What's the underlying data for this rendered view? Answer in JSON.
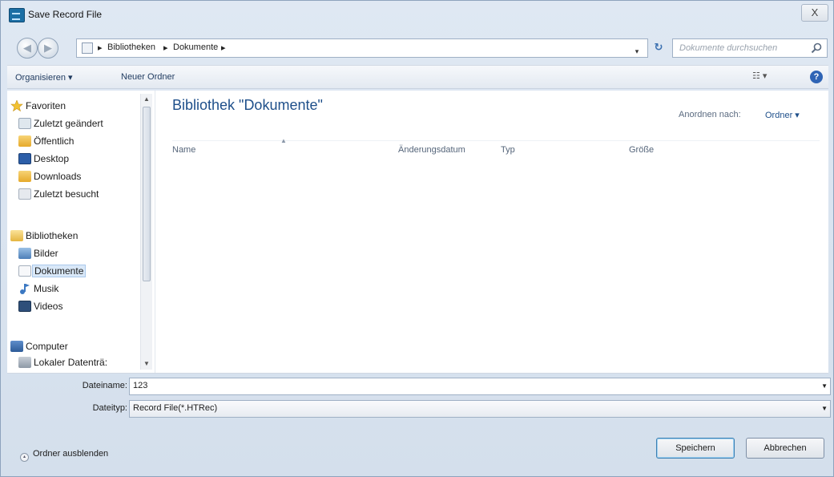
{
  "window": {
    "title": "Save Record File",
    "close_glyph": "X"
  },
  "address": {
    "crumbs": [
      "Bibliotheken",
      "Dokumente"
    ],
    "separator": "▸",
    "dropdown_glyph": "▾",
    "refresh_glyph": "↻"
  },
  "search": {
    "placeholder": "Dokumente durchsuchen",
    "icon": "search-icon"
  },
  "toolbar": {
    "organize_label": "Organisieren ▾",
    "new_folder_label": "Neuer Ordner",
    "view_label": "☷ ▾",
    "help_label": "?"
  },
  "navigation": {
    "favorites": {
      "label": "Favoriten",
      "items": [
        "Zuletzt geändert",
        "Öffentlich",
        "Desktop",
        "Downloads",
        "Zuletzt besucht"
      ]
    },
    "libraries": {
      "label": "Bibliotheken",
      "items": [
        "Bilder",
        "Dokumente",
        "Musik",
        "Videos"
      ],
      "selected": "Dokumente"
    },
    "computer": {
      "label": "Computer",
      "items": [
        "Lokaler Datenträ:"
      ]
    }
  },
  "content": {
    "library_title": "Bibliothek \"Dokumente\"",
    "arrange_label": "Anordnen nach:",
    "arrange_value": "Ordner ▾",
    "columns": [
      "Name",
      "Änderungsdatum",
      "Typ",
      "Größe"
    ]
  },
  "form": {
    "filename_label": "Dateiname:",
    "filename_value": "123",
    "filetype_label": "Dateityp:",
    "filetype_value": "Record File(*.HTRec)"
  },
  "footer": {
    "hide_folders_label": "Ordner ausblenden",
    "save_label": "Speichern",
    "cancel_label": "Abbrechen"
  },
  "colors": {
    "accent": "#1e4f8a",
    "selection": "#d9e8f8",
    "window_bg": "#dfe8f3"
  }
}
